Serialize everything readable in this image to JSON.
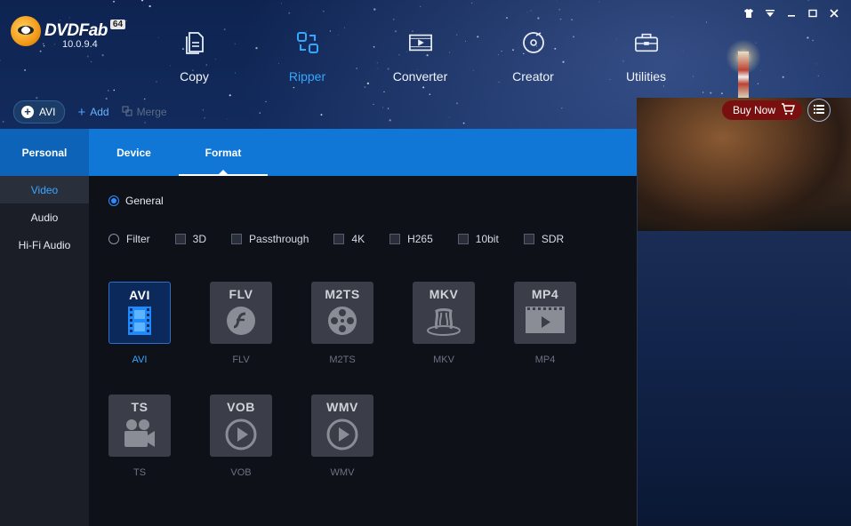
{
  "app": {
    "brand": "DVDFab",
    "bits": "64",
    "version": "10.0.9.4"
  },
  "window_controls": [
    "shirt-icon",
    "minimize-to-tray-icon",
    "minimize-icon",
    "maximize-icon",
    "close-icon"
  ],
  "modules": [
    {
      "label": "Copy",
      "icon": "copy-icon",
      "active": false
    },
    {
      "label": "Ripper",
      "icon": "ripper-icon",
      "active": true
    },
    {
      "label": "Converter",
      "icon": "converter-icon",
      "active": false
    },
    {
      "label": "Creator",
      "icon": "creator-icon",
      "active": false
    },
    {
      "label": "Utilities",
      "icon": "utilities-icon",
      "active": false
    }
  ],
  "toolbar": {
    "profile_label": "AVI",
    "add_label": "Add",
    "merge_label": "Merge"
  },
  "buy": {
    "label": "Buy Now"
  },
  "tabs": [
    {
      "label": "Personal",
      "active": false
    },
    {
      "label": "Device",
      "active": false
    },
    {
      "label": "Format",
      "active": true
    }
  ],
  "sidebar": [
    {
      "label": "Video",
      "active": true
    },
    {
      "label": "Audio",
      "active": false
    },
    {
      "label": "Hi-Fi Audio",
      "active": false
    }
  ],
  "options": {
    "general_label": "General",
    "filter_label": "Filter",
    "filters": [
      "3D",
      "Passthrough",
      "4K",
      "H265",
      "10bit",
      "SDR"
    ]
  },
  "formats": [
    {
      "title": "AVI",
      "label": "AVI",
      "icon": "film-strip-icon",
      "active": true
    },
    {
      "title": "FLV",
      "label": "FLV",
      "icon": "flash-icon",
      "active": false
    },
    {
      "title": "M2TS",
      "label": "M2TS",
      "icon": "film-reel-icon",
      "active": false
    },
    {
      "title": "MKV",
      "label": "MKV",
      "icon": "mkv-logo-icon",
      "active": false
    },
    {
      "title": "MP4",
      "label": "MP4",
      "icon": "play-frame-icon",
      "active": false
    },
    {
      "title": "TS",
      "label": "TS",
      "icon": "camera-icon",
      "active": false
    },
    {
      "title": "VOB",
      "label": "VOB",
      "icon": "play-circle-icon",
      "active": false
    },
    {
      "title": "WMV",
      "label": "WMV",
      "icon": "play-circle-icon",
      "active": false
    }
  ],
  "colors": {
    "accent": "#1177d6",
    "active_text": "#3ba6ff",
    "buy": "#7a0f0f"
  }
}
